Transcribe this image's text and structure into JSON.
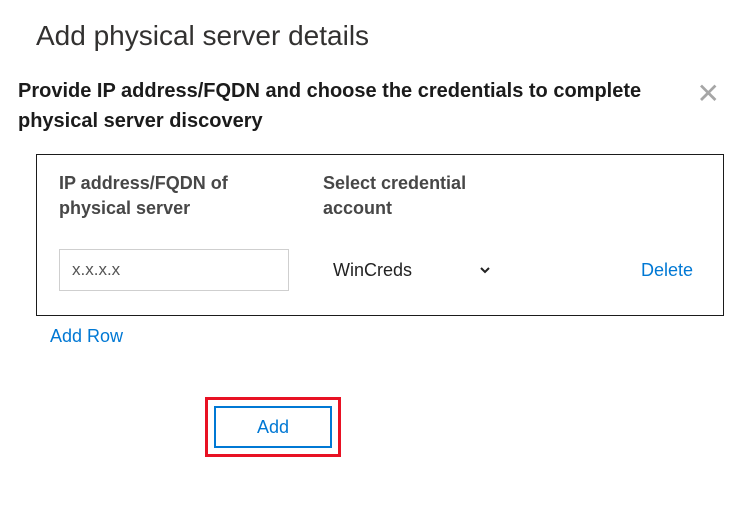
{
  "heading": "Add physical server details",
  "description": "Provide IP address/FQDN and choose the credentials to complete physical server discovery",
  "table": {
    "headers": {
      "ip": "IP address/FQDN of physical server",
      "cred": "Select credential account"
    },
    "rows": [
      {
        "ip_value": "x.x.x.x",
        "cred_value": "WinCreds",
        "delete_label": "Delete"
      }
    ]
  },
  "add_row_label": "Add Row",
  "add_button_label": "Add",
  "close_glyph": "✕"
}
